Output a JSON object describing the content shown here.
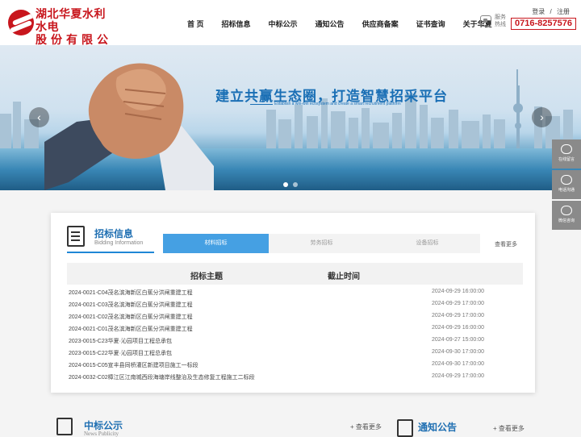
{
  "header": {
    "logo_line1": "湖北华夏水利水电",
    "logo_line2": "股份有限公司",
    "nav": [
      "首 页",
      "招标信息",
      "中标公示",
      "通知公告",
      "供应商备案",
      "证书查询",
      "关于华夏"
    ],
    "login": "登录",
    "separator": "/",
    "register": "注册",
    "hotline_label": "服务热线",
    "hotline_number": "0716-8257576"
  },
  "banner": {
    "title": "建立共赢生态圈，打造智慧招采平台",
    "subtitle": "Establish a win-win ecosystem and create a smart recruitment platform",
    "prev": "‹",
    "next": "›",
    "slide_count": 2,
    "active_slide": 1
  },
  "side": {
    "items": [
      {
        "label": "在线留言",
        "icon": "headset-icon"
      },
      {
        "label": "电话沟通",
        "icon": "phone-icon"
      },
      {
        "label": "微信咨询",
        "icon": "wechat-icon"
      }
    ]
  },
  "bidding": {
    "title": "招标信息",
    "subtitle": "Bidding Information",
    "tabs": [
      "材料招标",
      "劳务招标",
      "设备招标"
    ],
    "active_tab": 0,
    "more": "查看更多",
    "columns": [
      "招标主题",
      "截止时间"
    ],
    "rows": [
      {
        "title": "2024-0021-C04茂名滨海新区白蕉分洪闸重建工程",
        "deadline": "2024-09-29 16:00:00"
      },
      {
        "title": "2024-0021-C03茂名滨海新区白蕉分洪闸重建工程",
        "deadline": "2024-09-29 17:00:00"
      },
      {
        "title": "2024-0021-C02茂名滨海新区白蕉分洪闸重建工程",
        "deadline": "2024-09-29 17:00:00"
      },
      {
        "title": "2024-0021-C01茂名滨海新区白蕉分洪闸重建工程",
        "deadline": "2024-09-29 16:00:00"
      },
      {
        "title": "2023-0015-C23华夏·沁园项目工程总承包",
        "deadline": "2024-09-27 15:00:00"
      },
      {
        "title": "2023-0015-C22华夏·沁园项目工程总承包",
        "deadline": "2024-09-30 17:00:00"
      },
      {
        "title": "2024-0015-C05宣丰县同桥灌区新建项目施工一标段",
        "deadline": "2024-09-30 17:00:00"
      },
      {
        "title": "2024-0032-C02樟江区江南城西段海塘岸线整治及生态修复工程施工二标段",
        "deadline": "2024-09-29 17:00:00"
      }
    ]
  },
  "news": {
    "title": "中标公示",
    "subtitle": "News Publicity",
    "more": "+ 查看更多"
  },
  "notice": {
    "title": "通知公告",
    "more": "+ 查看更多"
  }
}
